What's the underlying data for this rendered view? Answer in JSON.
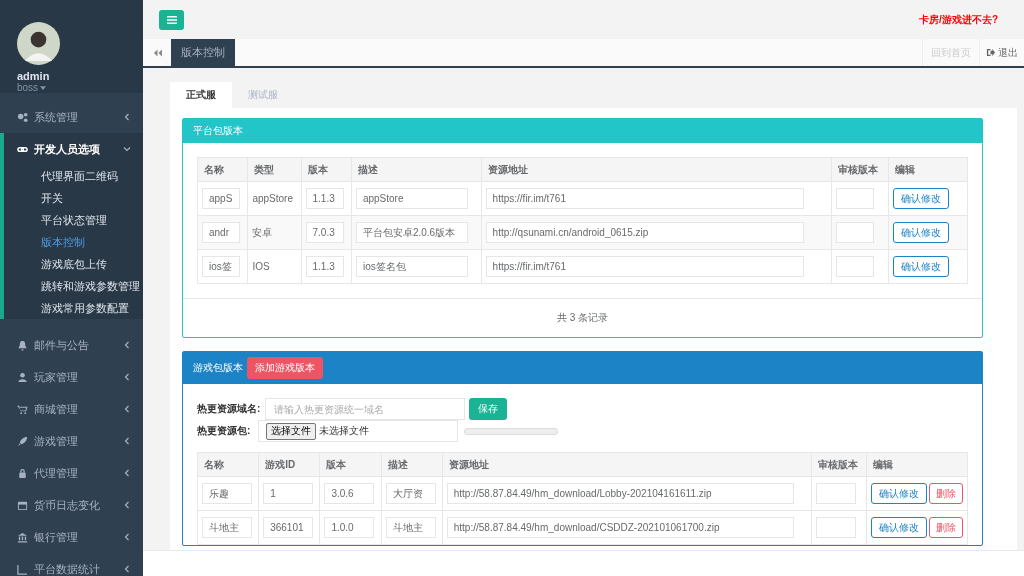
{
  "user": {
    "name": "admin",
    "role": "boss"
  },
  "sidebar": {
    "items": [
      {
        "label": "系统管理",
        "expanded": false
      },
      {
        "label": "开发人员选项",
        "expanded": true,
        "children": [
          {
            "label": "代理界面二维码",
            "selected": false
          },
          {
            "label": "开关",
            "selected": false
          },
          {
            "label": "平台状态管理",
            "selected": false
          },
          {
            "label": "版本控制",
            "selected": true
          },
          {
            "label": "游戏底包上传",
            "selected": false
          },
          {
            "label": "跳转和游戏参数管理",
            "selected": false
          },
          {
            "label": "游戏常用参数配置",
            "selected": false
          }
        ]
      },
      {
        "label": "邮件与公告",
        "expanded": false
      },
      {
        "label": "玩家管理",
        "expanded": false
      },
      {
        "label": "商城管理",
        "expanded": false
      },
      {
        "label": "游戏管理",
        "expanded": false
      },
      {
        "label": "代理管理",
        "expanded": false
      },
      {
        "label": "货币日志变化",
        "expanded": false
      },
      {
        "label": "银行管理",
        "expanded": false
      },
      {
        "label": "平台数据统计",
        "expanded": false
      }
    ]
  },
  "topbar": {
    "alert": "卡房/游戏进不去?"
  },
  "page_tabs": {
    "tabs": [
      {
        "label": "版本控制",
        "selected": true
      }
    ],
    "home": "回到首页",
    "logout": "退出"
  },
  "server_tabs": [
    {
      "label": "正式服",
      "selected": true
    },
    {
      "label": "测试服",
      "selected": false
    }
  ],
  "platform_panel": {
    "title": "平台包版本",
    "columns": [
      "名称",
      "类型",
      "版本",
      "描述",
      "资源地址",
      "审核版本",
      "编辑"
    ],
    "rows": [
      {
        "name": "appS",
        "type": "appStore",
        "version": "1.1.3",
        "description": "appStore",
        "url": "https://fir.im/t761",
        "button": "确认修改"
      },
      {
        "name": "andr",
        "type": "安卓",
        "version": "7.0.3",
        "description": "平台包安卓2.0.6版本",
        "url": "http://qsunami.cn/android_0615.zip",
        "button": "确认修改"
      },
      {
        "name": "ios签",
        "type": "IOS",
        "version": "1.1.3",
        "description": "ios签名包",
        "url": "https://fir.im/t761",
        "button": "确认修改"
      }
    ],
    "footer": "共 3 条记录"
  },
  "game_panel": {
    "title": "游戏包版本",
    "add_button": "添加游戏版本",
    "domain_field": {
      "label": "热更资源域名:",
      "placeholder": "请输入热更资源统一域名"
    },
    "save_button": "保存",
    "package_field": {
      "label": "热更资源包:",
      "button": "选择文件",
      "status": "未选择文件"
    },
    "upload_progress": {
      "level": 0
    },
    "columns": [
      "名称",
      "游戏ID",
      "版本",
      "描述",
      "资源地址",
      "审核版本",
      "编辑"
    ],
    "rows": [
      {
        "name": "乐趣",
        "game_id": "1",
        "version": "3.0.6",
        "description": "大厅资",
        "url": "http://58.87.84.49/hm_download/Lobby-202104161611.zip",
        "edit_button": "确认修改",
        "delete_button": "删除"
      },
      {
        "name": "斗地主",
        "game_id": "366101",
        "version": "1.0.0",
        "description": "斗地主",
        "url": "http://58.87.84.49/hm_download/CSDDZ-202101061700.zip",
        "edit_button": "确认修改",
        "delete_button": "删除"
      }
    ]
  }
}
